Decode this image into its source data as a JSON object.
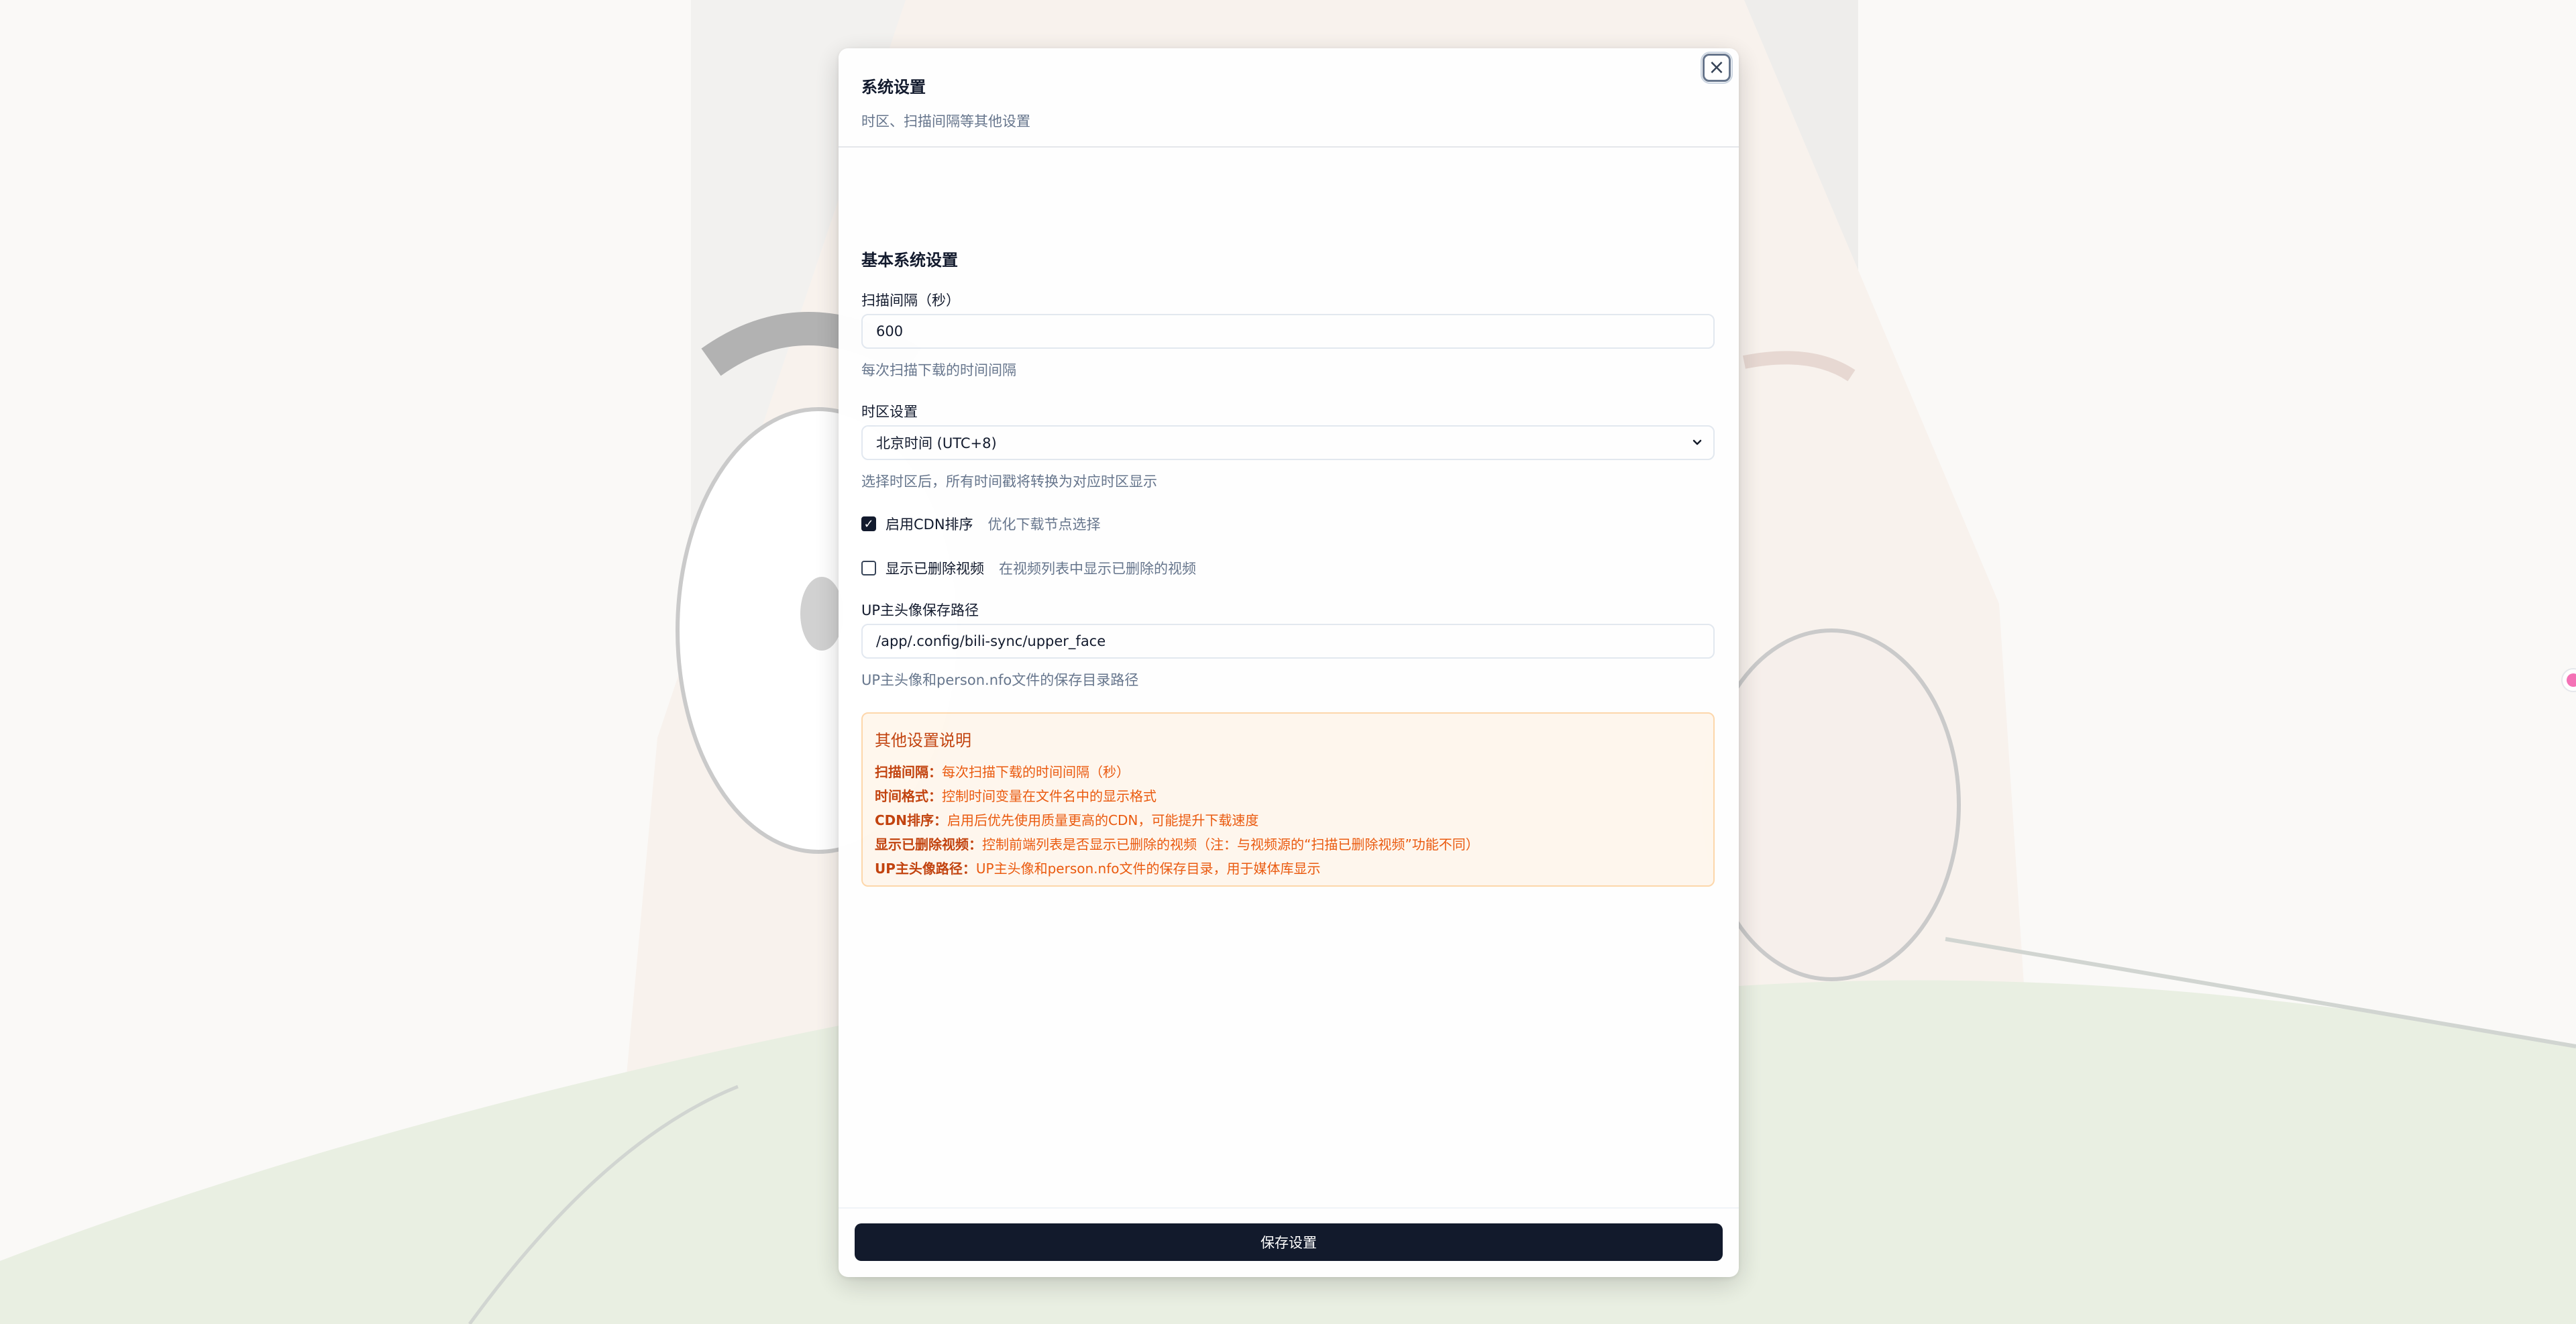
{
  "dialog": {
    "title": "系统设置",
    "subtitle": "时区、扫描间隔等其他设置",
    "close_icon": "close-icon"
  },
  "section": {
    "title": "基本系统设置"
  },
  "scan_interval": {
    "label": "扫描间隔（秒）",
    "value": "600",
    "hint": "每次扫描下载的时间间隔"
  },
  "timezone": {
    "label": "时区设置",
    "selected": "北京时间 (UTC+8)",
    "hint": "选择时区后，所有时间戳将转换为对应时区显示"
  },
  "cdn_sorting": {
    "label": "启用CDN排序",
    "description": "优化下载节点选择",
    "checked": true
  },
  "show_deleted": {
    "label": "显示已删除视频",
    "description": "在视频列表中显示已删除的视频",
    "checked": false
  },
  "avatar_path": {
    "label": "UP主头像保存路径",
    "value": "/app/.config/bili-sync/upper_face",
    "hint": "UP主头像和person.nfo文件的保存目录路径"
  },
  "info": {
    "title": "其他设置说明",
    "lines": [
      {
        "key": "扫描间隔：",
        "text": "每次扫描下载的时间间隔（秒）"
      },
      {
        "key": "时间格式：",
        "text": "控制时间变量在文件名中的显示格式"
      },
      {
        "key": "CDN排序：",
        "text": "启用后优先使用质量更高的CDN，可能提升下载速度"
      },
      {
        "key": "显示已删除视频：",
        "text": "控制前端列表是否显示已删除的视频（注：与视频源的“扫描已删除视频”功能不同）"
      },
      {
        "key": "UP主头像路径：",
        "text": "UP主头像和person.nfo文件的保存目录，用于媒体库显示"
      }
    ]
  },
  "footer": {
    "save_label": "保存设置"
  },
  "colors": {
    "primary": "#0f172a",
    "muted": "#64748b",
    "info_bg": "#fff7ed",
    "info_text": "#ea580c"
  }
}
